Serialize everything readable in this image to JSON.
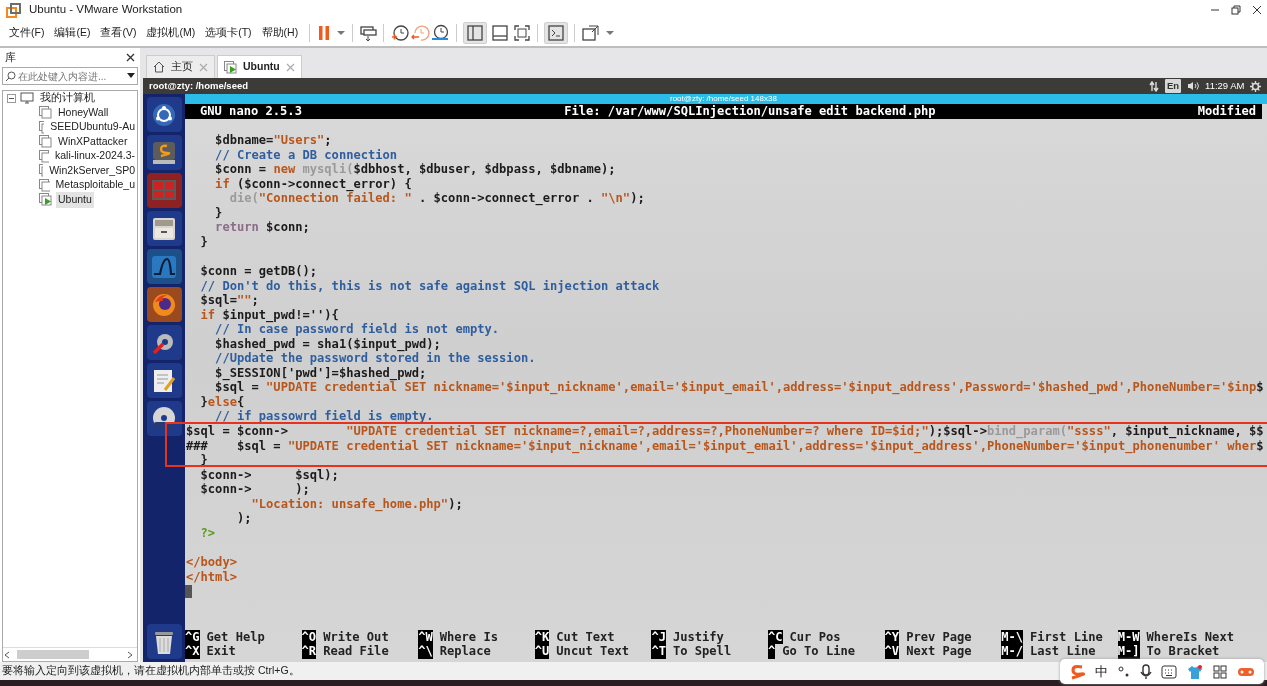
{
  "window": {
    "title": "Ubuntu - VMware Workstation"
  },
  "menu": [
    "文件(F)",
    "编辑(E)",
    "查看(V)",
    "虚拟机(M)",
    "选项卡(T)",
    "帮助(H)"
  ],
  "library": {
    "title": "库",
    "search": {
      "placeholder": "在此处键入内容进..."
    },
    "tree": [
      {
        "label": "我的计算机",
        "expanded": true,
        "selected": false,
        "children": [
          {
            "label": "HoneyWall",
            "selected": false,
            "running": false
          },
          {
            "label": "SEEDUbuntu9-Au",
            "selected": false,
            "running": false
          },
          {
            "label": "WinXPattacker",
            "selected": false,
            "running": false
          },
          {
            "label": "kali-linux-2024.3-",
            "selected": false,
            "running": false
          },
          {
            "label": "Win2kServer_SP0",
            "selected": false,
            "running": false
          },
          {
            "label": "Metasploitable_u",
            "selected": false,
            "running": false
          },
          {
            "label": "Ubuntu",
            "selected": true,
            "running": true
          }
        ]
      }
    ]
  },
  "tabs": [
    {
      "label": "主页",
      "kind": "home",
      "selected": false
    },
    {
      "label": "Ubuntu",
      "kind": "vm",
      "selected": true
    }
  ],
  "guest": {
    "top_bar": {
      "title": "root@zty: /home/seed",
      "keyboard": "En",
      "time": "11:29 AM"
    },
    "terminal": {
      "title": "root@zty: /home/seed 148x38",
      "nano": {
        "version": "GNU nano 2.5.3",
        "file": "File: /var/www/SQLInjection/unsafe edit backend.php",
        "state": "Modified"
      },
      "lines": [
        {
          "gap_before": true,
          "segments": [
            {
              "kind": "plain",
              "text": "    $dbname="
            },
            {
              "kind": "string",
              "text": "\"Users\""
            },
            {
              "kind": "plain",
              "text": ";"
            }
          ]
        },
        {
          "segments": [
            {
              "kind": "comment",
              "text": "    // Create a DB connection"
            }
          ]
        },
        {
          "segments": [
            {
              "kind": "plain",
              "text": "    $conn = "
            },
            {
              "kind": "keyword",
              "text": "new"
            },
            {
              "kind": "faint",
              "text": " mysqli("
            },
            {
              "kind": "plain",
              "text": "$dbhost, $dbuser, $dbpass, $dbname);"
            }
          ]
        },
        {
          "segments": [
            {
              "kind": "keyword",
              "text": "    if"
            },
            {
              "kind": "plain",
              "text": " ($conn->connect_error) {"
            }
          ]
        },
        {
          "segments": [
            {
              "kind": "faint",
              "text": "      die("
            },
            {
              "kind": "string",
              "text": "\"Connection failed: \""
            },
            {
              "kind": "plain",
              "text": " . $conn->connect_error . "
            },
            {
              "kind": "string",
              "text": "\"\\n\""
            },
            {
              "kind": "plain",
              "text": ");"
            }
          ]
        },
        {
          "segments": [
            {
              "kind": "plain",
              "text": "    }"
            }
          ]
        },
        {
          "segments": [
            {
              "kind": "return",
              "text": "    return"
            },
            {
              "kind": "plain",
              "text": " $conn;"
            }
          ]
        },
        {
          "segments": [
            {
              "kind": "plain",
              "text": "  }"
            }
          ]
        },
        {
          "gap_before": true,
          "segments": [
            {
              "kind": "plain",
              "text": "  $conn = getDB();"
            }
          ]
        },
        {
          "segments": [
            {
              "kind": "comment",
              "text": "  // Don't do this, this is not safe against SQL injection attack"
            }
          ]
        },
        {
          "segments": [
            {
              "kind": "plain",
              "text": "  $sql="
            },
            {
              "kind": "string",
              "text": "\"\""
            },
            {
              "kind": "plain",
              "text": ";"
            }
          ]
        },
        {
          "segments": [
            {
              "kind": "keyword",
              "text": "  if"
            },
            {
              "kind": "plain",
              "text": " $input_pwd!=''){"
            }
          ]
        },
        {
          "segments": [
            {
              "kind": "comment",
              "text": "    // In case password field is not empty."
            }
          ]
        },
        {
          "segments": [
            {
              "kind": "plain",
              "text": "    $hashed_pwd = sha1($input_pwd);"
            }
          ]
        },
        {
          "segments": [
            {
              "kind": "comment",
              "text": "    //Update the password stored in the session."
            }
          ]
        },
        {
          "segments": [
            {
              "kind": "plain",
              "text": "    $_SESSION['pwd']=$hashed_pwd;"
            }
          ]
        },
        {
          "segments": [
            {
              "kind": "plain",
              "text": "    $sql = "
            },
            {
              "kind": "string",
              "text": "\"UPDATE credential SET nickname='$input_nickname',email='$input_email',address='$input_address',Password='$hashed_pwd',PhoneNumber='$inp"
            },
            {
              "kind": "plain",
              "text": "$"
            }
          ]
        },
        {
          "segments": [
            {
              "kind": "plain",
              "text": "  }"
            },
            {
              "kind": "keyword",
              "text": "else"
            },
            {
              "kind": "plain",
              "text": "{"
            }
          ]
        },
        {
          "segments": [
            {
              "kind": "comment",
              "text": "    // if passowrd field is empty."
            }
          ]
        },
        {
          "segments": [
            {
              "kind": "plain",
              "text": "$sql = $conn->        "
            },
            {
              "kind": "string",
              "text": "\"UPDATE credential SET nickname=?,email=?,address=?,PhoneNumber=? where ID=$id;\""
            },
            {
              "kind": "plain",
              "text": ");$sql->"
            },
            {
              "kind": "faint",
              "text": "bind_param("
            },
            {
              "kind": "string",
              "text": "\"ssss\""
            },
            {
              "kind": "plain",
              "text": ", $input_nickname, $$"
            }
          ]
        },
        {
          "segments": [
            {
              "kind": "plain",
              "text": "###    $sql = "
            },
            {
              "kind": "string",
              "text": "\"UPDATE credential SET nickname='$input_nickname',email='$input_email',address='$input_address',PhoneNumber='$input_phonenumber' wher"
            },
            {
              "kind": "plain",
              "text": "$"
            }
          ]
        },
        {
          "segments": [
            {
              "kind": "plain",
              "text": "  }"
            }
          ]
        },
        {
          "segments": [
            {
              "kind": "plain",
              "text": "  $conn->      $sql);"
            }
          ]
        },
        {
          "segments": [
            {
              "kind": "plain",
              "text": "  $conn->      );"
            }
          ]
        },
        {
          "segments": [
            {
              "kind": "string",
              "text": "         \"Location: unsafe_home.php\""
            },
            {
              "kind": "plain",
              "text": ");"
            }
          ]
        },
        {
          "segments": [
            {
              "kind": "plain",
              "text": "       );"
            }
          ]
        },
        {
          "segments": [
            {
              "kind": "php",
              "text": "  ?>"
            }
          ]
        },
        {
          "gap_before": true,
          "segments": [
            {
              "kind": "tag",
              "text": "</body>"
            }
          ]
        },
        {
          "segments": [
            {
              "kind": "tag",
              "text": "</html>"
            }
          ]
        }
      ],
      "shortcuts": [
        [
          {
            "key": "^G",
            "label": "Get Help"
          },
          {
            "key": "^X",
            "label": "Exit"
          }
        ],
        [
          {
            "key": "^O",
            "label": "Write Out"
          },
          {
            "key": "^R",
            "label": "Read File"
          }
        ],
        [
          {
            "key": "^W",
            "label": "Where Is"
          },
          {
            "key": "^\\",
            "label": "Replace"
          }
        ],
        [
          {
            "key": "^K",
            "label": "Cut Text"
          },
          {
            "key": "^U",
            "label": "Uncut Text"
          }
        ],
        [
          {
            "key": "^J",
            "label": "Justify"
          },
          {
            "key": "^T",
            "label": "To Spell"
          }
        ],
        [
          {
            "key": "^C",
            "label": "Cur Pos"
          },
          {
            "key": "^",
            "label": "Go To Line"
          }
        ],
        [
          {
            "key": "^Y",
            "label": "Prev Page"
          },
          {
            "key": "^V",
            "label": "Next Page"
          }
        ],
        [
          {
            "key": "M-\\",
            "label": "First Line"
          },
          {
            "key": "M-/",
            "label": "Last Line"
          }
        ],
        [
          {
            "key": "M-W",
            "label": "WhereIs Next"
          },
          {
            "key": "M-]",
            "label": "To Bracket"
          }
        ]
      ]
    }
  },
  "status_bar": "要将输入定向到该虚拟机，请在虚拟机内部单击或按 Ctrl+G。",
  "ime": {
    "mode": "中"
  }
}
